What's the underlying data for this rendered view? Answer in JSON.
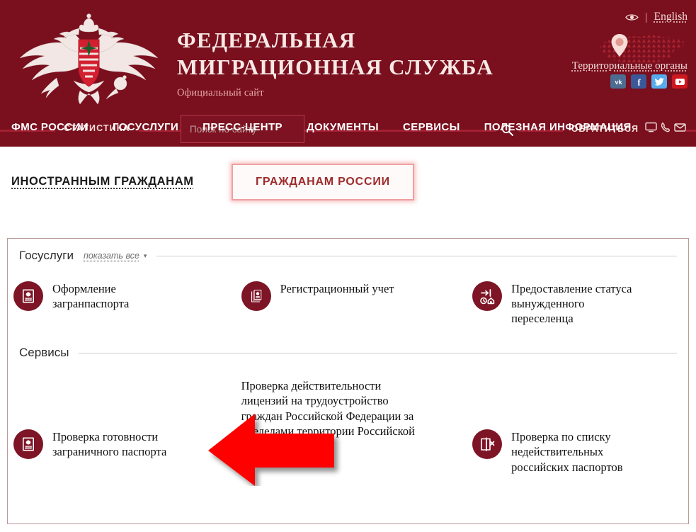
{
  "header": {
    "brand_line1": "ФЕДЕРАЛЬНАЯ",
    "brand_line2": "МИГРАЦИОННАЯ СЛУЖБА",
    "subtitle": "Официальный сайт",
    "emblem_name": "double-headed-eagle-emblem",
    "accessibility_icon": "eye-icon",
    "lang_separator": "|",
    "language": "English",
    "territorial_link": "Территориальные органы",
    "map_icon": "russia-map-with-pin-icon",
    "socials": [
      {
        "name": "vk-icon",
        "label": "VK",
        "color": "#4c6c91"
      },
      {
        "name": "facebook-icon",
        "label": "f",
        "color": "#3b5998"
      },
      {
        "name": "twitter-icon",
        "label": "t",
        "color": "#55acee"
      },
      {
        "name": "youtube-icon",
        "label": "YouTube",
        "color": "#cc181e"
      }
    ]
  },
  "strip": {
    "statistics_label": "СТАТИСТИКА",
    "search_placeholder": "Поиск по сайту",
    "search_value": "",
    "search_icon": "search-icon",
    "contact_label": "ОБРАТИТЬСЯ",
    "contact_icons": [
      "monitor-icon",
      "phone-icon",
      "envelope-icon"
    ]
  },
  "mainnav": {
    "items": [
      "ФМС РОССИИ",
      "ГОСУСЛУГИ",
      "ПРЕСС-ЦЕНТР",
      "ДОКУМЕНТЫ",
      "СЕРВИСЫ",
      "ПОЛЕЗНАЯ ИНФОРМАЦИЯ"
    ]
  },
  "tabs": {
    "inactive": "ИНОСТРАННЫМ ГРАЖДАНАМ",
    "active": "ГРАЖДАНАМ РОССИИ"
  },
  "sections": [
    {
      "title": "Госуслуги",
      "show_all": "показать все",
      "caret": "▾",
      "cards": [
        {
          "icon": "passport-pass-icon",
          "label": "Оформление\nзагранпаспорта"
        },
        {
          "icon": "registration-document-icon",
          "label": "Регистрационный учет"
        },
        {
          "icon": "forced-migrant-status-icon",
          "label": "Предоставление статуса\nвынужденного\nпереселенца"
        }
      ]
    },
    {
      "title": "Сервисы",
      "show_all": "",
      "caret": "",
      "cards": [
        {
          "icon": "passport-pass-icon",
          "label": "Проверка готовности\nзаграничного паспорта"
        },
        {
          "icon": "license-check-icon",
          "label": "Проверка действительности лицензий на трудоустройство граждан Российской Федерации за пределами территории Российской Федерации"
        },
        {
          "icon": "invalid-passport-icon",
          "label": "Проверка по списку\nнедействительных\nроссийских паспортов"
        }
      ]
    }
  ],
  "annotation": {
    "arrow_icon": "red-left-arrow-annotation",
    "color": "#FF0000"
  },
  "colors": {
    "header_bg": "#7a0f1e",
    "nav_rule": "#a32032",
    "accent_red": "#9d2b2b",
    "icon_circle": "#7d1526",
    "panel_border": "#b99a9a"
  }
}
